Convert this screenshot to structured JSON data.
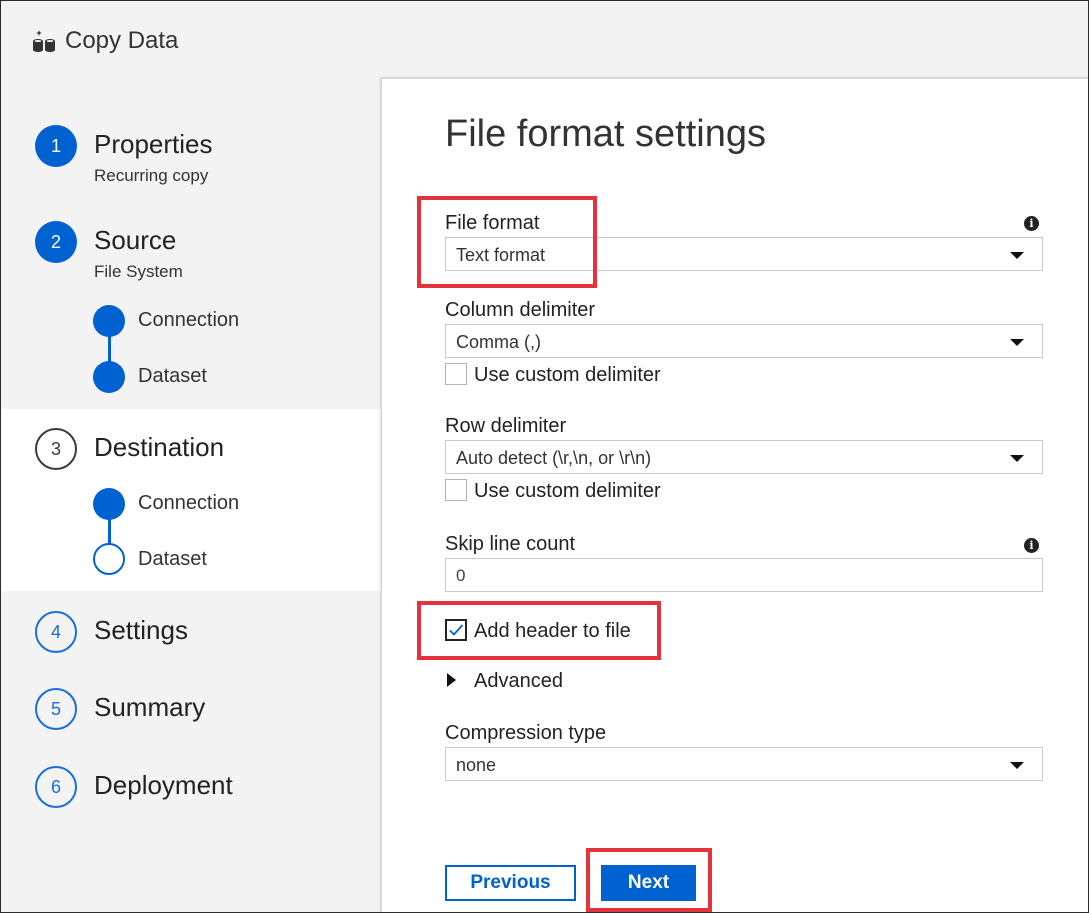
{
  "app": {
    "title": "Copy Data",
    "icon": "copy-data-icon"
  },
  "steps": [
    {
      "number": "1",
      "title": "Properties",
      "subtitle": "Recurring copy"
    },
    {
      "number": "2",
      "title": "Source",
      "subtitle": "File System",
      "substeps": [
        {
          "label": "Connection"
        },
        {
          "label": "Dataset"
        }
      ]
    },
    {
      "number": "3",
      "title": "Destination",
      "substeps": [
        {
          "label": "Connection"
        },
        {
          "label": "Dataset"
        }
      ]
    },
    {
      "number": "4",
      "title": "Settings"
    },
    {
      "number": "5",
      "title": "Summary"
    },
    {
      "number": "6",
      "title": "Deployment"
    }
  ],
  "main": {
    "heading": "File format settings",
    "file_format": {
      "label": "File format",
      "value": "Text format"
    },
    "column_delimiter": {
      "label": "Column delimiter",
      "value": "Comma (,)",
      "custom_label": "Use custom delimiter",
      "custom_checked": false
    },
    "row_delimiter": {
      "label": "Row delimiter",
      "value": "Auto detect (\\r,\\n, or \\r\\n)",
      "custom_label": "Use custom delimiter",
      "custom_checked": false
    },
    "skip_line_count": {
      "label": "Skip line count",
      "value": "0"
    },
    "add_header": {
      "label": "Add header to file",
      "checked": true
    },
    "advanced": {
      "label": "Advanced"
    },
    "compression": {
      "label": "Compression type",
      "value": "none"
    }
  },
  "buttons": {
    "previous": "Previous",
    "next": "Next"
  },
  "colors": {
    "accent": "#0062d1",
    "highlight": "#e5323b"
  }
}
